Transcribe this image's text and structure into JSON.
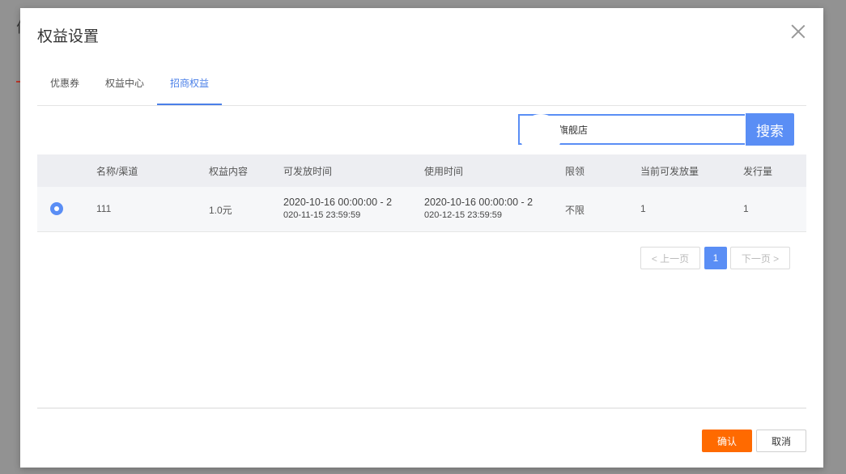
{
  "background": {
    "left_glyph": "优",
    "right_glyph": ""
  },
  "modal": {
    "title": "权益设置",
    "close_icon": "close-icon"
  },
  "tabs": [
    {
      "label": "优惠券",
      "active": false
    },
    {
      "label": "权益中心",
      "active": false
    },
    {
      "label": "招商权益",
      "active": true
    }
  ],
  "search": {
    "value": "旗舰店",
    "button_label": "搜索"
  },
  "table": {
    "headers": [
      "名称/渠道",
      "权益内容",
      "可发放时间",
      "使用时间",
      "限领",
      "当前可发放量",
      "发行量"
    ],
    "rows": [
      {
        "selected": true,
        "name": "111",
        "content": "1.0元",
        "issue_time_1": "2020-10-16 00:00:00 - 2",
        "issue_time_2": "020-11-15 23:59:59",
        "use_time_1": "2020-10-16 00:00:00 - 2",
        "use_time_2": "020-12-15 23:59:59",
        "limit": "不限",
        "available": "1",
        "issued": "1"
      }
    ]
  },
  "pagination": {
    "prev_label": "< 上一页",
    "current": "1",
    "next_label": "下一页 >"
  },
  "footer": {
    "ok_label": "确认",
    "cancel_label": "取消"
  },
  "colors": {
    "primary": "#5a8ef5",
    "confirm": "#ff6a00",
    "tab_active": "#4a7fe8"
  }
}
